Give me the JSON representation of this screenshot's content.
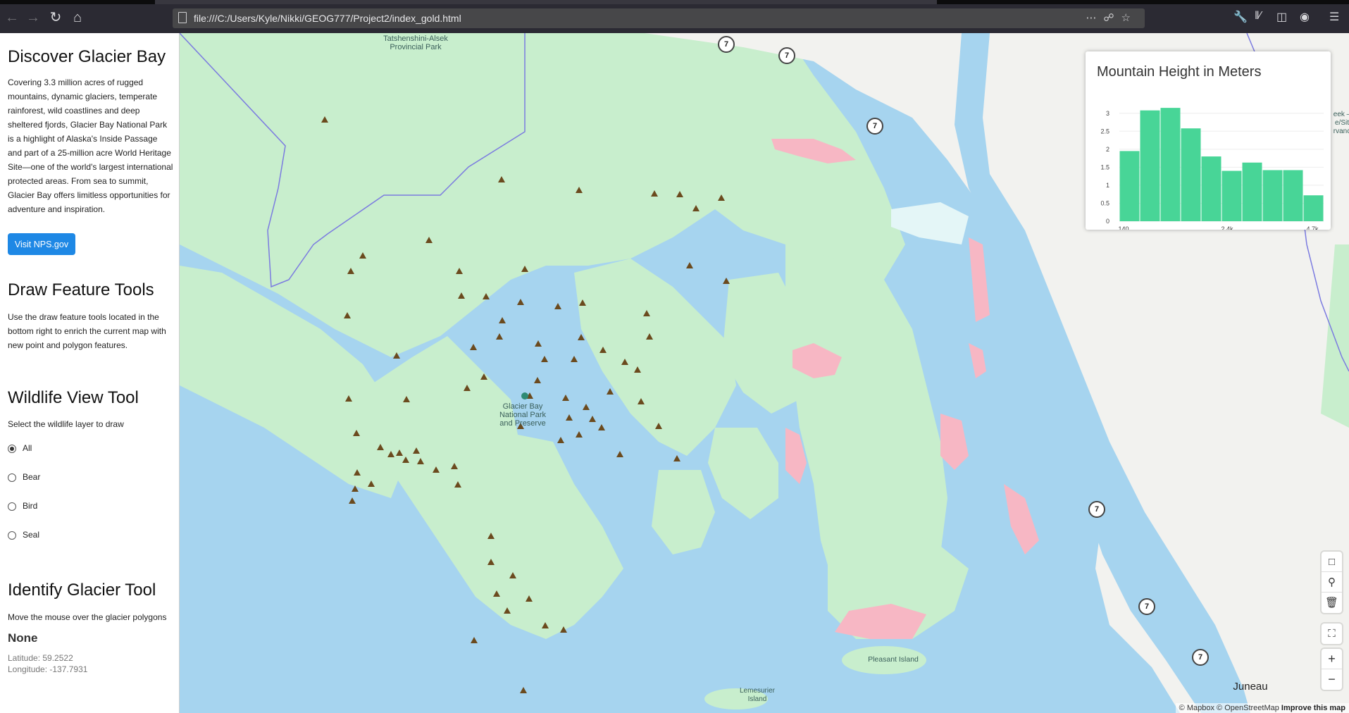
{
  "browser": {
    "url": "file:///C:/Users/Kyle/Nikki/GEOG777/Project2/index_gold.html"
  },
  "sidebar": {
    "discover": {
      "title": "Discover Glacier Bay",
      "body": "Covering 3.3 million acres of rugged mountains, dynamic glaciers, temperate rainforest, wild coastlines and deep sheltered fjords, Glacier Bay National Park is a highlight of Alaska's Inside Passage and part of a 25-million acre World Heritage Site—one of the world's largest international protected areas. From sea to summit, Glacier Bay offers limitless opportunities for adventure and inspiration.",
      "button": "Visit NPS.gov"
    },
    "draw": {
      "title": "Draw Feature Tools",
      "body": "Use the draw feature tools located in the bottom right to enrich the current map with new point and polygon features."
    },
    "wildlife": {
      "title": "Wildlife View Tool",
      "prompt": "Select the wildlife layer to draw",
      "options": [
        "All",
        "Bear",
        "Bird",
        "Seal"
      ],
      "selected": "All"
    },
    "identify": {
      "title": "Identify Glacier Tool",
      "prompt": "Move the mouse over the glacier polygons",
      "glacier": "None",
      "latitude": "Latitude: 59.2522",
      "longitude": "Longitude: -137.7931"
    }
  },
  "map": {
    "labels": {
      "tatshenshini": "Tatshenshini-Alsek Provincial Park",
      "glacier_bay": "Glacier Bay National Park and Preserve",
      "pleasant": "Pleasant Island",
      "lemesurier": "Lemesurier Island",
      "juneau": "Juneau",
      "edge": "eek – e/Sit rvanc"
    },
    "route_label": "7",
    "attribution": {
      "mapbox": "© Mapbox",
      "osm": "© OpenStreetMap",
      "improve": "Improve this map"
    },
    "colors": {
      "water": "#a6d4ef",
      "park": "#c8eecd",
      "terrain": "#f2f2ef",
      "glacier": "#f7b7c4",
      "mountain": "#6b4a1e"
    }
  },
  "chart_data": {
    "type": "bar",
    "title": "Mountain Height in Meters",
    "values": [
      1.95,
      3.08,
      3.15,
      2.58,
      1.8,
      1.4,
      1.63,
      1.42,
      1.42,
      0.72
    ],
    "ylim": [
      0,
      3.25
    ],
    "yticks": [
      "0",
      "0.5",
      "1",
      "1.5",
      "2",
      "2.5",
      "3"
    ],
    "xticks": [
      "140",
      "2.4k",
      "4.7k"
    ],
    "color": "#48d597"
  }
}
